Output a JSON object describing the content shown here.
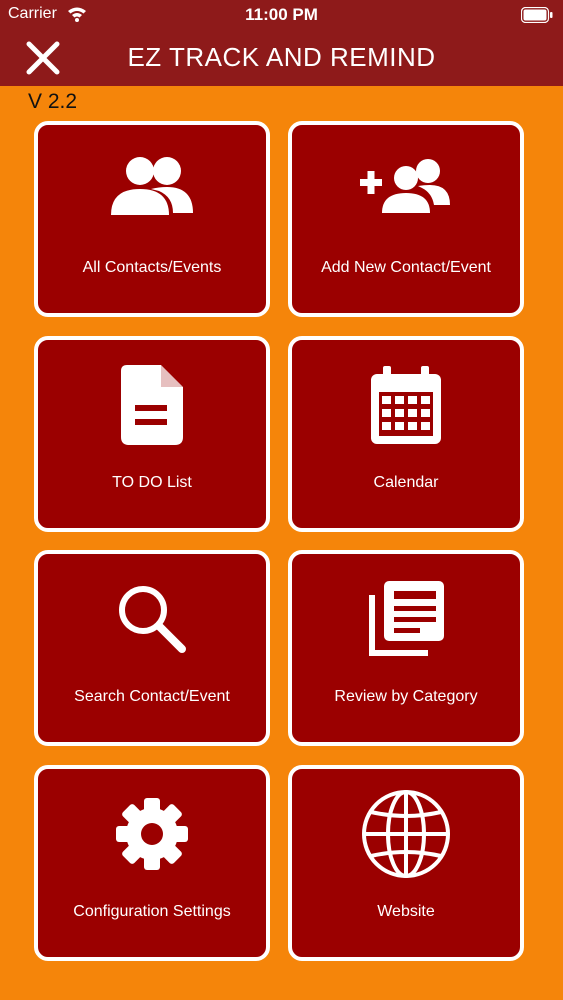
{
  "status_bar": {
    "carrier": "Carrier",
    "time": "11:00 PM"
  },
  "header": {
    "title": "EZ TRACK AND REMIND"
  },
  "version": "V 2.2",
  "colors": {
    "background": "#F5850A",
    "header": "#8E1A1A",
    "tile": "#9B0000",
    "tile_border": "#FFFFFF"
  },
  "tiles": [
    {
      "label": "All Contacts/Events",
      "icon": "users-icon"
    },
    {
      "label": "Add New Contact/Event",
      "icon": "user-plus-icon"
    },
    {
      "label": "TO DO List",
      "icon": "document-icon"
    },
    {
      "label": "Calendar",
      "icon": "calendar-icon"
    },
    {
      "label": "Search Contact/Event",
      "icon": "search-icon"
    },
    {
      "label": "Review by Category",
      "icon": "list-copy-icon"
    },
    {
      "label": "Configuration Settings",
      "icon": "gear-icon"
    },
    {
      "label": "Website",
      "icon": "globe-icon"
    }
  ]
}
